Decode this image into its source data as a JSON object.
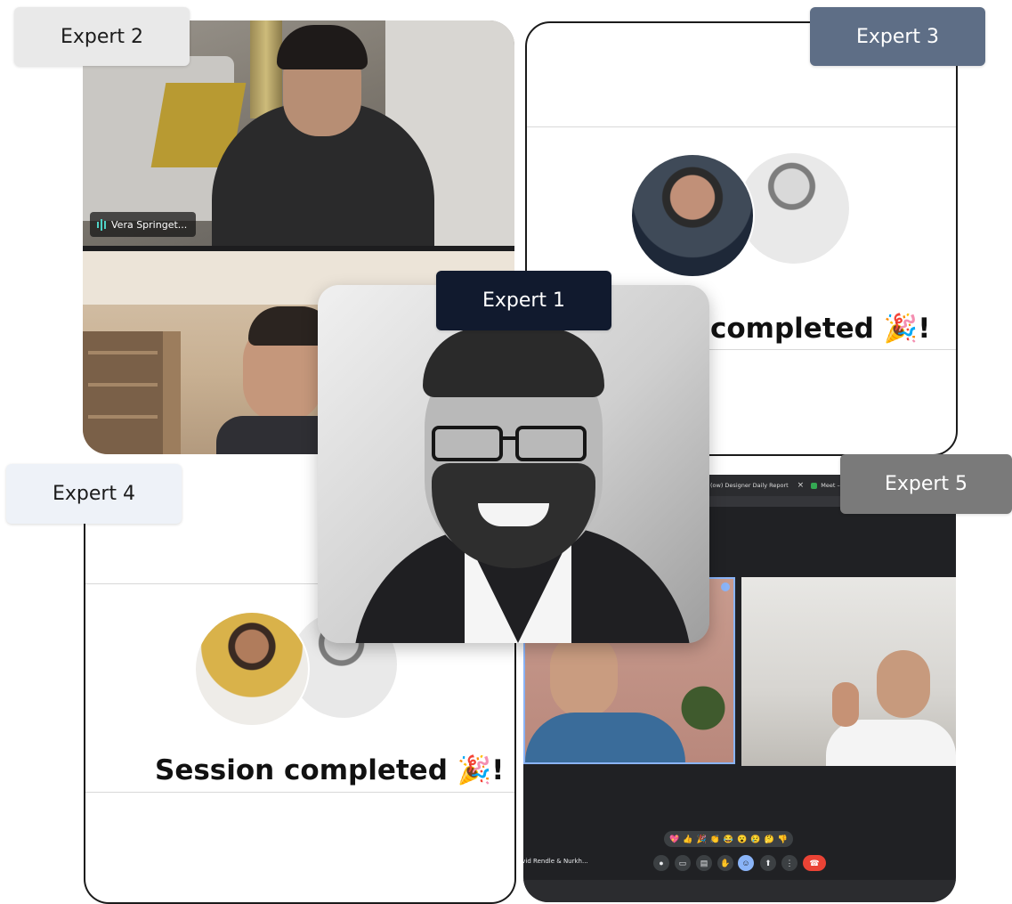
{
  "labels": {
    "expert1": "Expert 1",
    "expert2": "Expert 2",
    "expert3": "Expert 3",
    "expert4": "Expert 4",
    "expert5": "Expert 5"
  },
  "card2": {
    "participant_name": "Vera Springet..."
  },
  "card3": {
    "status_text": "completed 🎉!"
  },
  "card4": {
    "status_text": "Session completed 🎉!"
  },
  "card5": {
    "tab_1": "(ow) Designer Daily Report",
    "tab_close": "×",
    "tab_2": "Meet – AO",
    "meeting_title": "avid Rendle & Nurkh...",
    "reactions": [
      "💖",
      "👍",
      "🎉",
      "👏",
      "😂",
      "😮",
      "😢",
      "🤔",
      "👎"
    ],
    "controls": [
      "mic-icon",
      "camera-icon",
      "captions-icon",
      "hand-icon",
      "emoji-icon",
      "present-icon",
      "more-icon",
      "end-call-icon"
    ]
  },
  "colors": {
    "expert1_label_bg": "#111a2e",
    "expert2_label_bg": "#e9e9e9",
    "expert3_label_bg": "#5e6e86",
    "expert4_label_bg": "#eef2f8",
    "expert5_label_bg": "#7a7a7a",
    "end_call_red": "#ea4335",
    "meet_dark_bg": "#202124"
  }
}
